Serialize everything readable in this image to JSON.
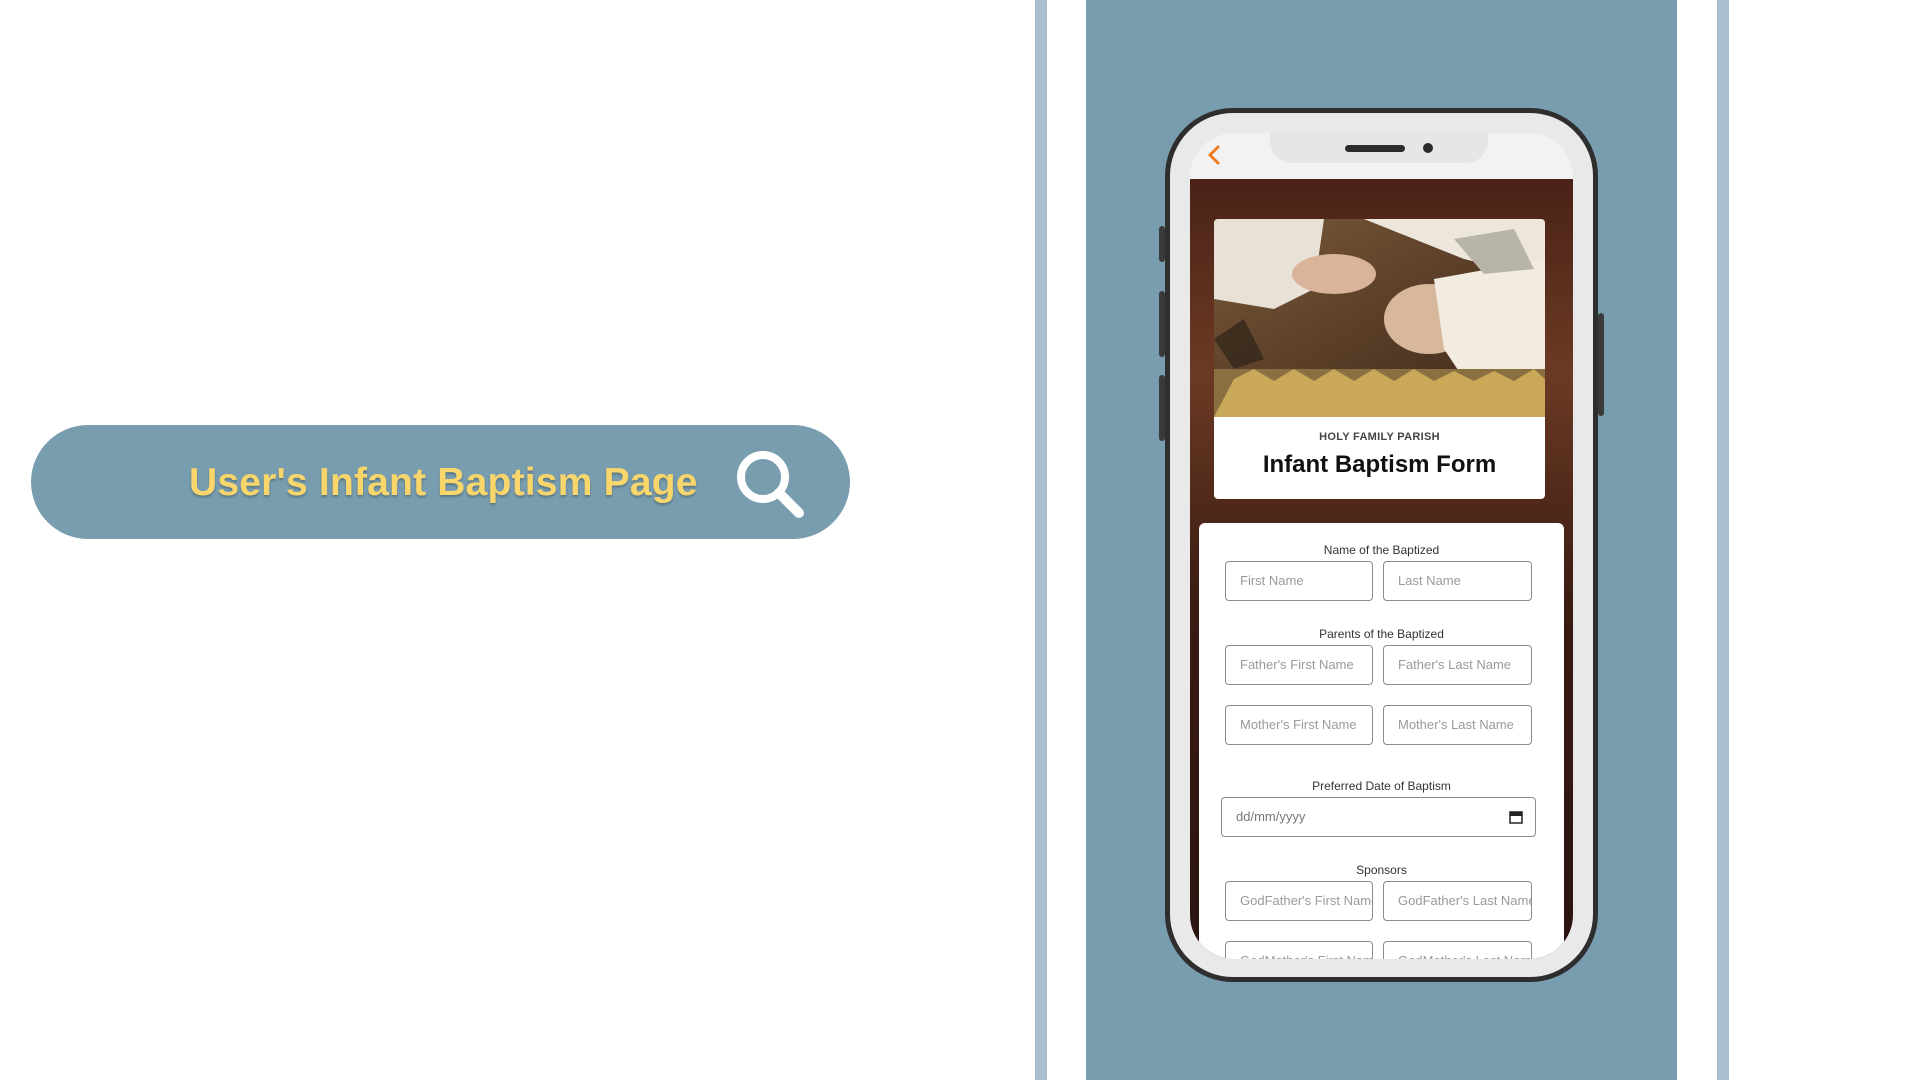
{
  "banner": {
    "title": "User's Infant Baptism Page",
    "icon": "search-icon"
  },
  "colors": {
    "panel": "#789daf",
    "stripe": "#a9bfcd",
    "title_text": "#f8d66b",
    "back_accent": "#f07a1c"
  },
  "app": {
    "back_icon": "chevron-left-icon",
    "parish": "HOLY FAMILY PARISH",
    "form_title": "Infant Baptism Form"
  },
  "form": {
    "baptized_label": "Name of the Baptized",
    "first_name_placeholder": "First Name",
    "last_name_placeholder": "Last Name",
    "parents_label": "Parents of the Baptized",
    "father_first_placeholder": "Father's First Name",
    "father_last_placeholder": "Father's Last Name",
    "mother_first_placeholder": "Mother's First Name",
    "mother_last_placeholder": "Mother's Last Name",
    "date_label": "Preferred Date of Baptism",
    "date_placeholder": "dd/mm/yyyy",
    "sponsors_label": "Sponsors",
    "godfather_first_placeholder": "GodFather's First Name",
    "godfather_last_placeholder": "GodFather's Last Name",
    "godmother_first_placeholder": "GodMother's First Name",
    "godmother_last_placeholder": "GodMother's Last Name"
  }
}
